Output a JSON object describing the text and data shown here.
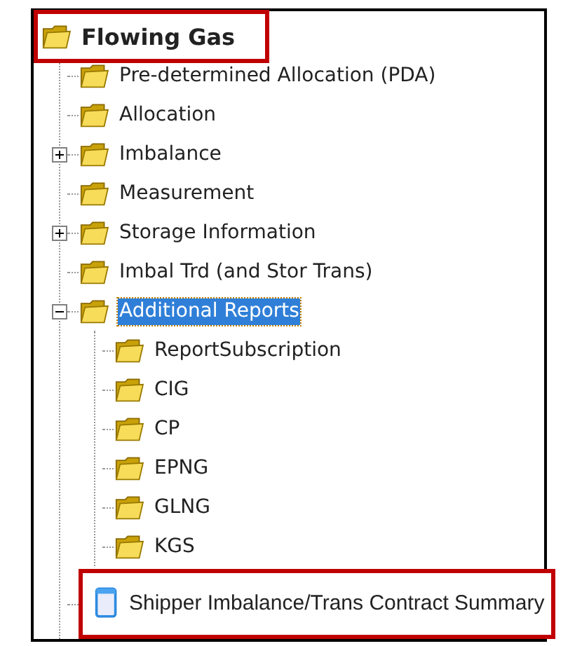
{
  "tree": {
    "label": "Flowing Gas",
    "kind": "folder",
    "highlighted": true,
    "selected": false,
    "expandable": false,
    "expanded": true,
    "children": [
      {
        "label": "Pre-determined Allocation (PDA)",
        "kind": "folder",
        "highlighted": false,
        "selected": false,
        "expandable": false
      },
      {
        "label": "Allocation",
        "kind": "folder",
        "highlighted": false,
        "selected": false,
        "expandable": false
      },
      {
        "label": "Imbalance",
        "kind": "folder",
        "highlighted": false,
        "selected": false,
        "expandable": true,
        "expanded": false
      },
      {
        "label": "Measurement",
        "kind": "folder",
        "highlighted": false,
        "selected": false,
        "expandable": false
      },
      {
        "label": "Storage Information",
        "kind": "folder",
        "highlighted": false,
        "selected": false,
        "expandable": true,
        "expanded": false
      },
      {
        "label": "Imbal Trd (and Stor Trans)",
        "kind": "folder",
        "highlighted": false,
        "selected": false,
        "expandable": false
      },
      {
        "label": "Additional Reports",
        "kind": "folder",
        "highlighted": false,
        "selected": true,
        "expandable": true,
        "expanded": true,
        "children": [
          {
            "label": "ReportSubscription",
            "kind": "folder",
            "highlighted": false,
            "selected": false,
            "expandable": false
          },
          {
            "label": "CIG",
            "kind": "folder",
            "highlighted": false,
            "selected": false,
            "expandable": false
          },
          {
            "label": "CP",
            "kind": "folder",
            "highlighted": false,
            "selected": false,
            "expandable": false
          },
          {
            "label": "EPNG",
            "kind": "folder",
            "highlighted": false,
            "selected": false,
            "expandable": false
          },
          {
            "label": "GLNG",
            "kind": "folder",
            "highlighted": false,
            "selected": false,
            "expandable": false
          },
          {
            "label": "KGS",
            "kind": "folder",
            "highlighted": false,
            "selected": false,
            "expandable": false
          }
        ]
      },
      {
        "label": "Shipper Imbalance/Trans Contract Summary",
        "kind": "report",
        "highlighted": true,
        "selected": false,
        "expandable": false
      }
    ]
  }
}
